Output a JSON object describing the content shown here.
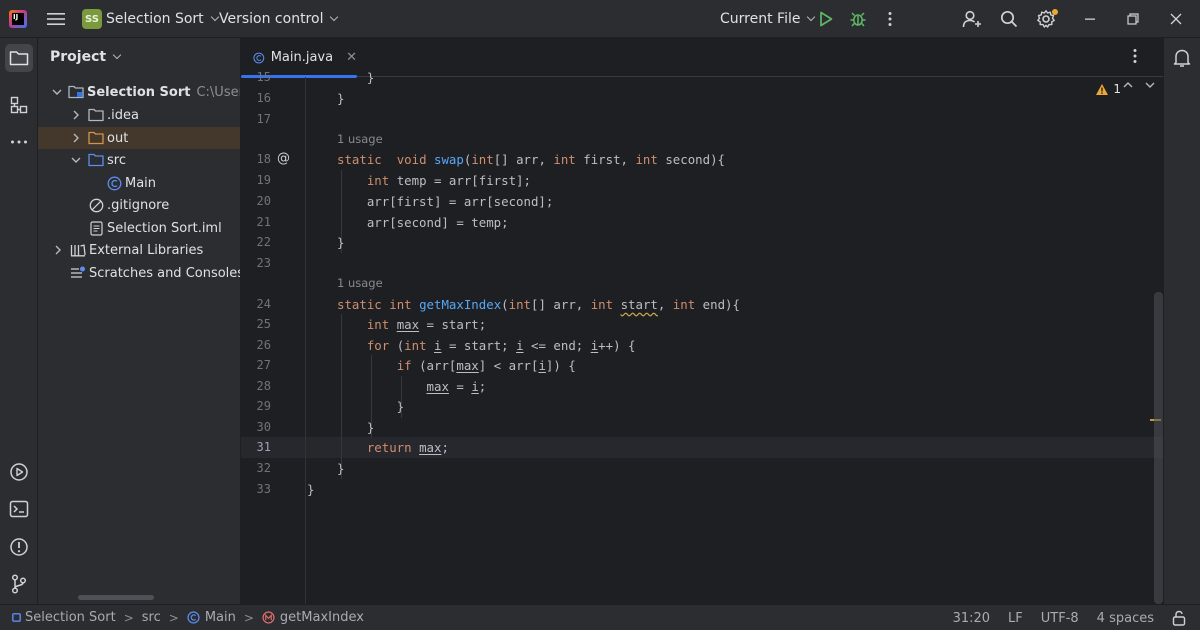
{
  "titlebar": {
    "project_badge": "SS",
    "project_name": "Selection Sort",
    "vcs_label": "Version control",
    "run_config": "Current File"
  },
  "project_panel": {
    "title": "Project",
    "items": [
      {
        "label": "Selection Sort",
        "path": "C:\\Users\\n"
      },
      {
        "label": ".idea"
      },
      {
        "label": "out"
      },
      {
        "label": "src"
      },
      {
        "label": "Main"
      },
      {
        "label": ".gitignore"
      },
      {
        "label": "Selection Sort.iml"
      },
      {
        "label": "External Libraries"
      },
      {
        "label": "Scratches and Consoles"
      }
    ]
  },
  "editor": {
    "tab_title": "Main.java",
    "warning_count": "1",
    "usage_hint": "1 usage",
    "line_numbers": [
      "15",
      "16",
      "17",
      "18",
      "19",
      "20",
      "21",
      "22",
      "23",
      "24",
      "25",
      "26",
      "27",
      "28",
      "29",
      "30",
      "31",
      "32",
      "33"
    ],
    "current_line": "31"
  },
  "statusbar": {
    "breadcrumbs": [
      "Selection Sort",
      "src",
      "Main",
      "getMaxIndex"
    ],
    "position": "31:20",
    "line_sep": "LF",
    "encoding": "UTF-8",
    "indent": "4 spaces"
  },
  "colors": {
    "accent": "#3574f0",
    "keyword": "#cf8e6d",
    "function": "#56a8f5",
    "warning": "#f0a732"
  }
}
